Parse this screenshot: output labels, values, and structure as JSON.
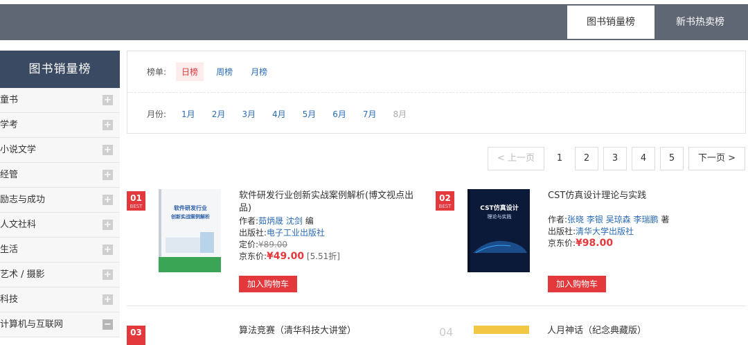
{
  "top_tabs": [
    {
      "label": "图书销量榜",
      "active": true
    },
    {
      "label": "新书热卖榜",
      "active": false
    }
  ],
  "sidebar": {
    "title": "图书销量榜",
    "items": [
      {
        "label": "童书",
        "toggle": "+"
      },
      {
        "label": "学考",
        "toggle": "+"
      },
      {
        "label": "小说文学",
        "toggle": "+"
      },
      {
        "label": "经管",
        "toggle": "+"
      },
      {
        "label": "励志与成功",
        "toggle": "+"
      },
      {
        "label": "人文社科",
        "toggle": "+"
      },
      {
        "label": "生活",
        "toggle": "+"
      },
      {
        "label": "艺术 / 摄影",
        "toggle": "+"
      },
      {
        "label": "科技",
        "toggle": "+"
      },
      {
        "label": "计算机与互联网",
        "toggle": "−"
      }
    ]
  },
  "filters": {
    "list_label": "榜单:",
    "lists": [
      "日榜",
      "周榜",
      "月榜"
    ],
    "month_label": "月份:",
    "months": [
      "1月",
      "2月",
      "3月",
      "4月",
      "5月",
      "6月",
      "7月",
      "8月"
    ]
  },
  "pager": {
    "prev": "< 上一页",
    "pages": [
      "1",
      "2",
      "3",
      "4",
      "5"
    ],
    "next": "下一页 >"
  },
  "books": [
    {
      "rank": "01",
      "badge_sub": "BEST",
      "cover_text_1": "软件研发行业",
      "cover_text_2": "创新实战案例解析",
      "title": "软件研发行业创新实战案例解析(博文视点出品)",
      "author_label": "作者:",
      "authors": "茹炳晟  沈剑",
      "author_suffix": " 编",
      "publisher_label": "出版社:",
      "publisher": "电子工业出版社",
      "list_price_label": "定价:",
      "list_price": "¥89.00",
      "jd_price_label": "京东价:",
      "jd_price": "¥49.00",
      "discount": "[5.51折]",
      "cart": "加入购物车"
    },
    {
      "rank": "02",
      "badge_sub": "BEST",
      "cover_text_1": "CST仿真设计",
      "cover_text_2": "理论与实践",
      "title": "CST仿真设计理论与实践",
      "author_label": "作者:",
      "authors": "张晓  李银  吴琼森  李瑞鹏",
      "author_suffix": " 著",
      "publisher_label": "出版社:",
      "publisher": "清华大学出版社",
      "jd_price_label": "京东价:",
      "jd_price": "¥98.00",
      "cart": "加入购物车"
    }
  ],
  "peek": {
    "rank3": "03",
    "title3": "算法竞赛（清华科技大讲堂）",
    "rank4": "04",
    "title4": "人月神话（纪念典藏版）"
  },
  "colors": {
    "accent": "#e4393c",
    "topbar": "#5f6674",
    "sidebar_head": "#3b4a63",
    "link": "#2a6bb3"
  }
}
